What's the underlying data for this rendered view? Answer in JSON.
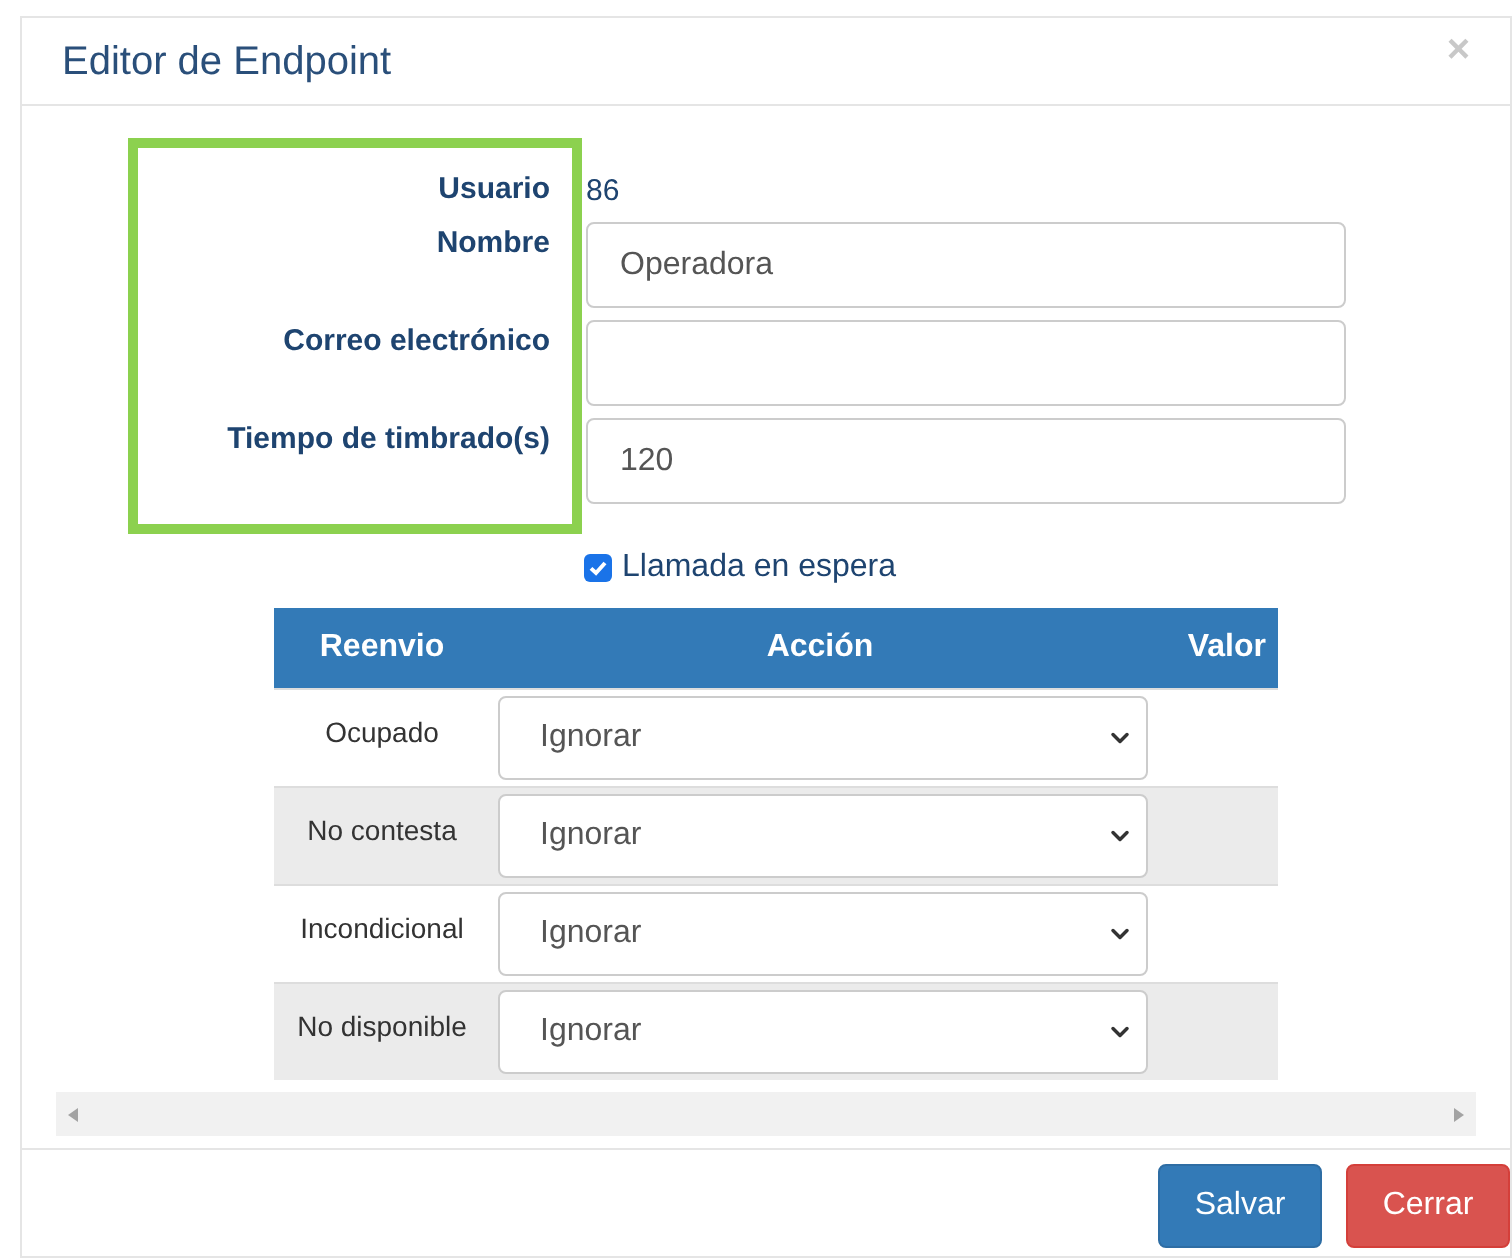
{
  "dialog": {
    "title": "Editor de Endpoint",
    "close": "×"
  },
  "form": {
    "user_label": "Usuario",
    "user_value": "86",
    "fields": [
      {
        "label": "Nombre",
        "value": "Operadora"
      },
      {
        "label": "Correo electrónico"
      },
      {
        "label": "Tiempo de timbrado(s)",
        "value": "120"
      }
    ],
    "call_waiting": {
      "label": "Llamada en espera",
      "checked": true
    }
  },
  "table": {
    "columns": [
      "Reenvio",
      "Acción",
      "Valor"
    ],
    "rows": [
      {
        "reenvio": "Ocupado",
        "accion": "Ignorar"
      },
      {
        "reenvio": "No contesta",
        "accion": "Ignorar"
      },
      {
        "reenvio": "Incondicional",
        "accion": "Ignorar"
      },
      {
        "reenvio": "No disponible",
        "accion": "Ignorar"
      }
    ]
  },
  "buttons": [
    {
      "label": "Salvar",
      "kind": "primary"
    },
    {
      "label": "Cerrar",
      "kind": "danger"
    }
  ]
}
